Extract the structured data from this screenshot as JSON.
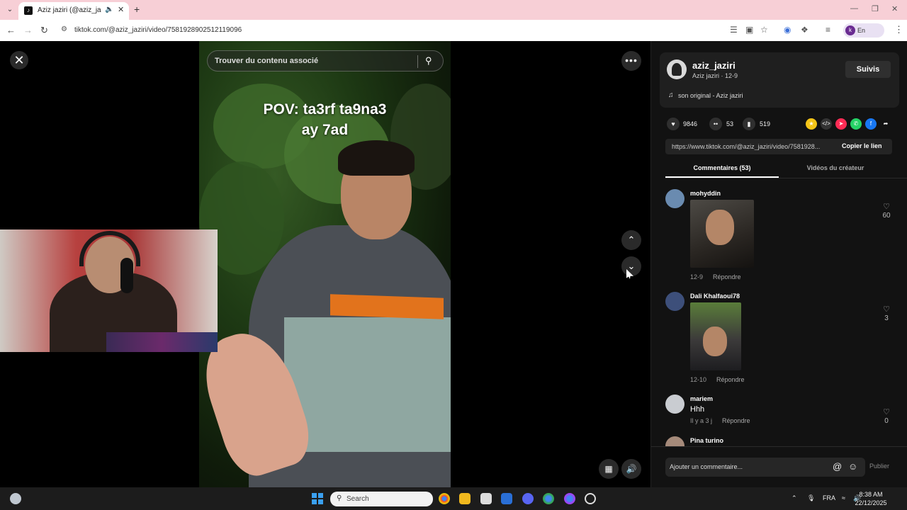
{
  "browser": {
    "tab_title": "Aziz jaziri (@aziz_jaziri) | Tik",
    "url": "tiktok.com/@aziz_jaziri/video/7581928902512119096",
    "profile_label": "En pause",
    "profile_initial": "k"
  },
  "video": {
    "search_placeholder": "Trouver du contenu associé",
    "caption_line1": "POV: ta3rf ta9na3",
    "caption_line2": "ay 7ad"
  },
  "creator": {
    "username": "aziz_jaziri",
    "subline": "Aziz jaziri · 12-9",
    "follow_label": "Suivis",
    "sound": "son original - Aziz jaziri"
  },
  "stats": {
    "likes": "9846",
    "comments": "53",
    "saves": "519"
  },
  "link": {
    "url": "https://www.tiktok.com/@aziz_jaziri/video/7581928...",
    "copy_label": "Copier le lien"
  },
  "tabs": {
    "comments": "Commentaires (53)",
    "creator_videos": "Vidéos du créateur"
  },
  "comments": [
    {
      "name": "mohyddin",
      "text": "",
      "date": "12-9",
      "reply": "Répondre",
      "likes": "60"
    },
    {
      "name": "Dali Khalfaoui78",
      "text": "",
      "date": "12-10",
      "reply": "Répondre",
      "likes": "3"
    },
    {
      "name": "mariem",
      "text": "Hhh",
      "date": "Il y a 3 j",
      "reply": "Répondre",
      "likes": "0"
    },
    {
      "name": "Pina turino",
      "text": "",
      "date": "",
      "reply": "",
      "likes": ""
    }
  ],
  "comment_bar": {
    "placeholder": "Ajouter un commentaire...",
    "publish_label": "Publier"
  },
  "taskbar": {
    "search_label": "Search",
    "language": "FRA",
    "time": "8:38 AM",
    "date": "22/12/2025"
  }
}
